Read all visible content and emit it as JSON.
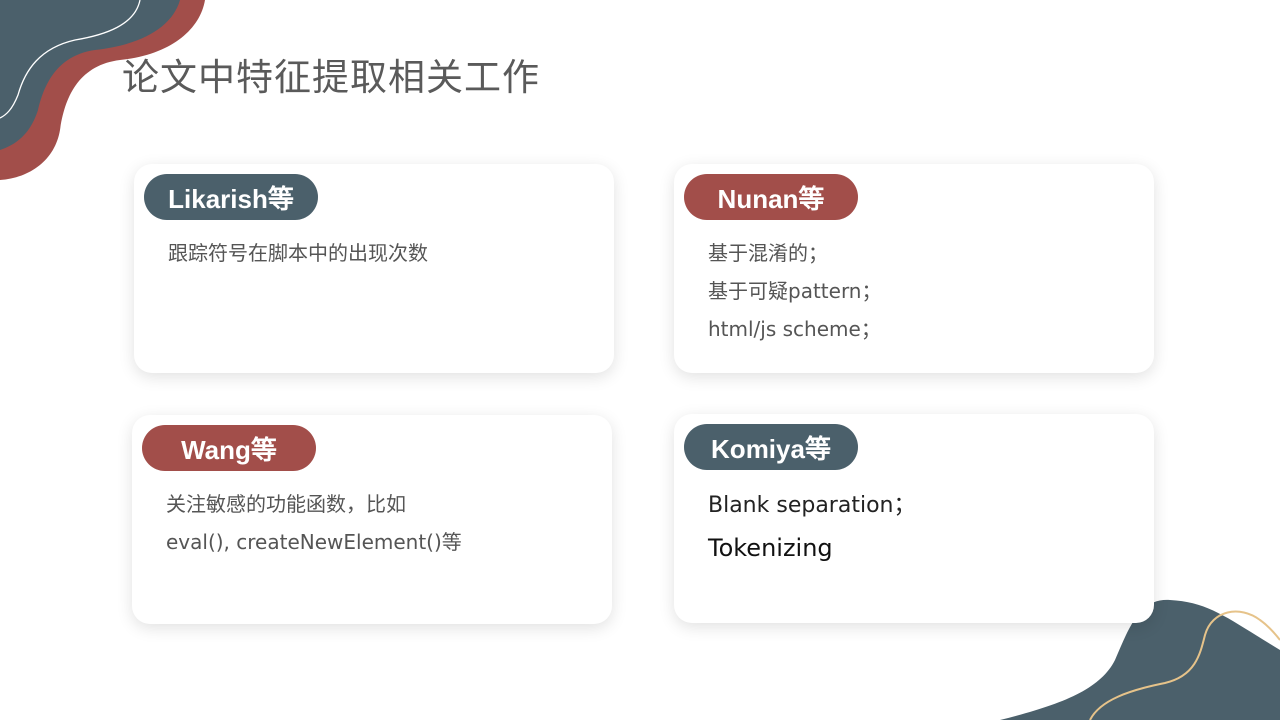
{
  "title": "论文中特征提取相关工作",
  "colors": {
    "slate": "#4b606b",
    "red": "#a24e4a",
    "gold": "#e6c38a"
  },
  "cards": [
    {
      "tag": "Likarish等",
      "tag_color": "slate",
      "lines": [
        "跟踪符号在脚本中的出现次数"
      ]
    },
    {
      "tag": "Nunan等",
      "tag_color": "red",
      "lines": [
        "基于混淆的；",
        "基于可疑pattern；",
        "html/js scheme；"
      ]
    },
    {
      "tag": "Wang等",
      "tag_color": "red",
      "lines": [
        "关注敏感的功能函数，比如",
        "eval(), createNewElement()等"
      ]
    },
    {
      "tag": "Komiya等",
      "tag_color": "slate",
      "lines": [
        "Blank separation；",
        "Tokenizing"
      ]
    }
  ]
}
